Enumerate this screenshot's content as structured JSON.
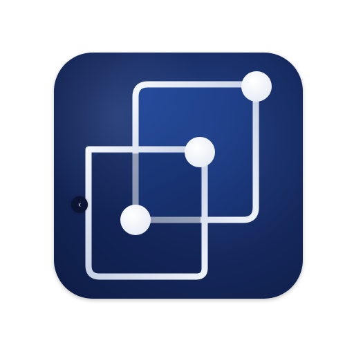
{
  "icon": {
    "name": "linked-squares-app-icon",
    "colors": {
      "background_dark": "#0e1c44",
      "background_mid": "#1c3470",
      "background_light": "#2a4a8e",
      "panel_fill": "#1f3f8a",
      "stroke": "#dfe6f2",
      "node": "#ffffff"
    }
  },
  "controls": {
    "back_glyph": "‹",
    "back_icon": "chevron-left-icon"
  }
}
